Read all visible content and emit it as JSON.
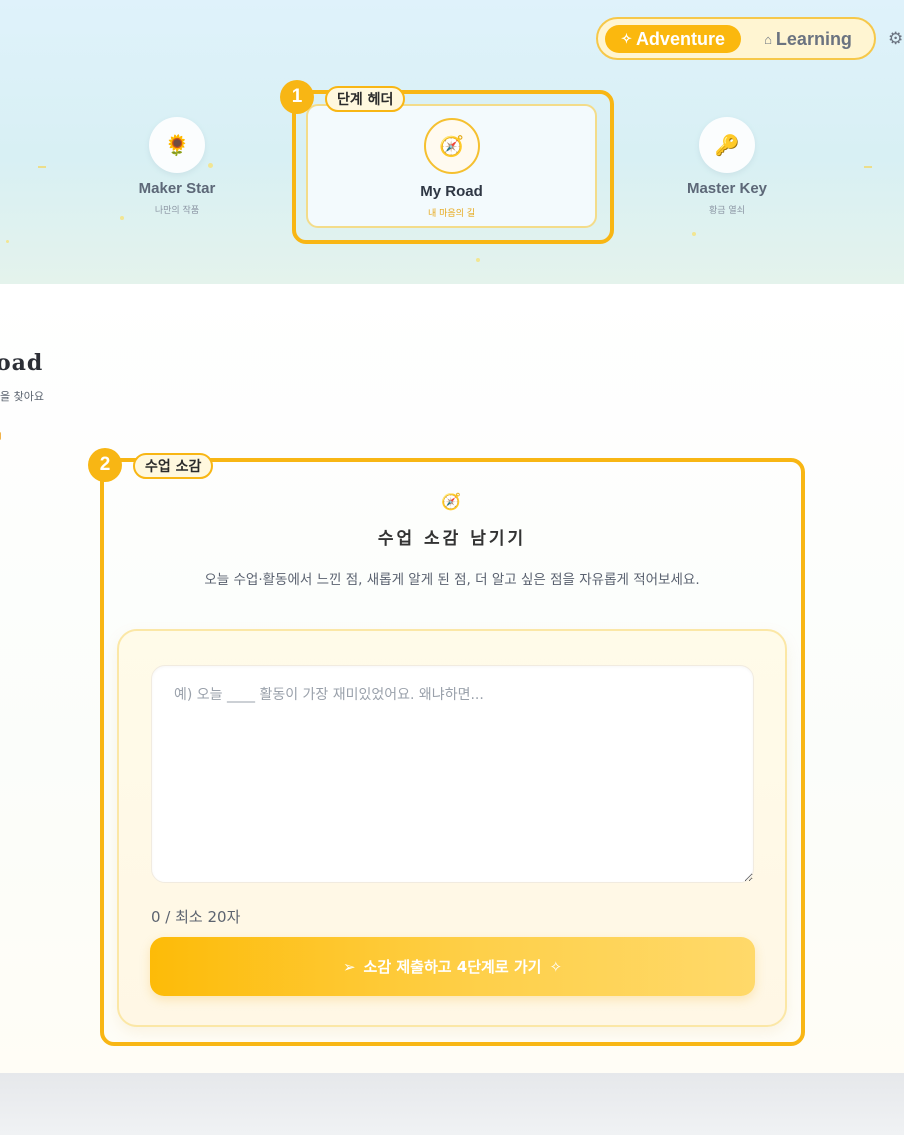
{
  "mode_toggle": {
    "adventure_label": "Adventure",
    "learning_label": "Learning",
    "adventure_icon": "sparkles-icon",
    "learning_icon": "graduation-cap-icon"
  },
  "steps": [
    {
      "name": "Maker Star",
      "sub": "나만의 작품",
      "icon": "sunflower-icon",
      "glyph": "🌻"
    },
    {
      "name": "My Road",
      "sub": "내 마음의 길",
      "icon": "compass-icon",
      "glyph": "🧭"
    },
    {
      "name": "Master Key",
      "sub": "황금 열쇠",
      "icon": "key-icon",
      "glyph": "🔑"
    }
  ],
  "annotations": [
    {
      "number": "1",
      "label": "단계 헤더"
    },
    {
      "number": "2",
      "label": "수업 소감"
    }
  ],
  "page": {
    "title": "oad",
    "subtitle": "을 찾아요"
  },
  "card": {
    "icon": "compass-icon",
    "glyph": "🧭",
    "title": "수업 소감 남기기",
    "description": "오늘 수업·활동에서 느낀 점, 새롭게 알게 된 점, 더 알고 싶은 점을 자유롭게 적어보세요."
  },
  "form": {
    "placeholder": "예) 오늘 ____ 활동이 가장 재미있었어요. 왜냐하면...",
    "value": "",
    "char_count": "0 / 최소 20자",
    "submit_label": "소감 제출하고 4단계로 가기"
  },
  "colors": {
    "accent": "#f8b614",
    "button_start": "#fdbb08",
    "button_end": "#ffd96a"
  }
}
